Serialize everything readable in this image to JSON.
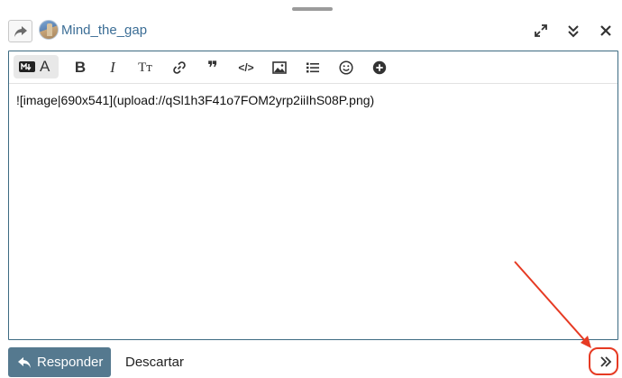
{
  "header": {
    "topic_title": "Mind_the_gap",
    "reply_to_icon": "share-arrow-icon",
    "avatar_icon": "avatar",
    "controls": [
      "fullscreen-icon",
      "collapse-double-chevron-icon",
      "close-icon"
    ]
  },
  "toolbar": {
    "items": [
      "markdown-toggle",
      "bold-icon",
      "italic-icon",
      "heading-icon",
      "link-icon",
      "quote-icon",
      "code-icon",
      "image-icon",
      "bullet-list-icon",
      "emoji-icon",
      "add-circle-icon"
    ],
    "bold_glyph": "B",
    "italic_glyph": "I",
    "heading_glyph": "Tт",
    "quote_glyph": "❞",
    "code_glyph": "</>",
    "mode_text": "A"
  },
  "editor": {
    "content": "![image|690x541](upload://qSl1h3F41o7FOM2yrp2iiIhS08P.png)"
  },
  "footer": {
    "reply_label": "Responder",
    "discard_label": "Descartar",
    "expand_icon": "double-chevron-right-icon"
  },
  "colors": {
    "accent": "#55798f",
    "link": "#3c6e96",
    "annotation": "#e63a23",
    "editor_border": "#3d6b82"
  }
}
